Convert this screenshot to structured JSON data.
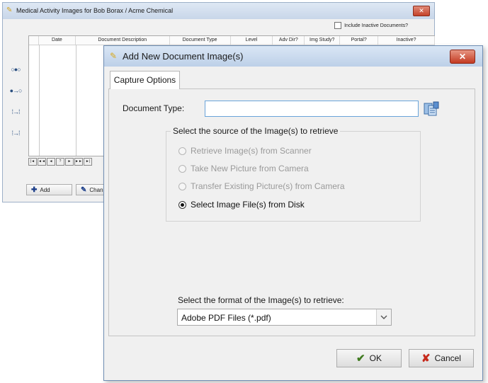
{
  "background_window": {
    "title": "Medical Activity Images for Bob Borax / Acme Chemical",
    "close_glyph": "✕",
    "include_inactive_label": "Include Inactive Documents?",
    "columns": [
      "Date",
      "Document Description",
      "Document Type",
      "Level",
      "Adv Dir?",
      "Img Study?",
      "Portal?",
      "Inactive?"
    ],
    "nav_buttons": [
      "|◄",
      "◄◄",
      "◄",
      "?",
      "►",
      "►►",
      "►|"
    ],
    "add_button": "Add",
    "change_button": "Chan"
  },
  "dialog": {
    "title": "Add New Document Image(s)",
    "close_glyph": "✕",
    "tab_label": "Capture Options",
    "document_type_label": "Document Type:",
    "document_type_value": "",
    "source_group_label": "Select the source of the Image(s) to retrieve",
    "sources": [
      {
        "label": "Retrieve Image(s) from Scanner",
        "enabled": false,
        "selected": false
      },
      {
        "label": "Take New Picture from Camera",
        "enabled": false,
        "selected": false
      },
      {
        "label": "Transfer Existing Picture(s) from Camera",
        "enabled": false,
        "selected": false
      },
      {
        "label": "Select Image File(s) from Disk",
        "enabled": true,
        "selected": true
      }
    ],
    "format_label": "Select the format of the Image(s) to retrieve:",
    "format_value": "Adobe PDF Files (*.pdf)",
    "ok_label": "OK",
    "cancel_label": "Cancel"
  },
  "colors": {
    "ok_check": "#3f7a1f",
    "cancel_x": "#c62a1c",
    "close_red": "#c43b22",
    "input_focus": "#6aa4d9"
  }
}
